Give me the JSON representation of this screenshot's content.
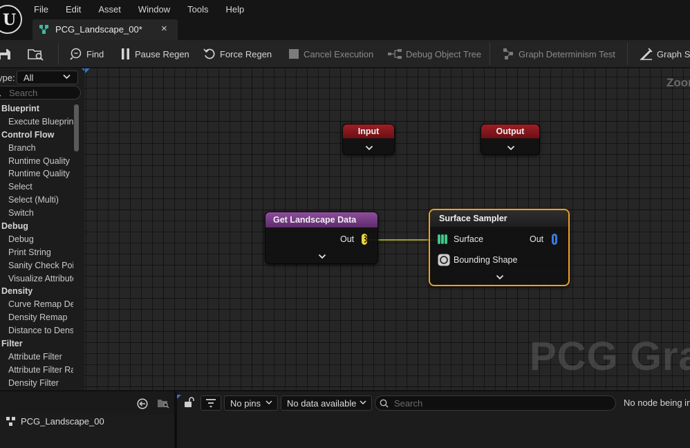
{
  "app": {
    "logo_text": "U",
    "menu": [
      "File",
      "Edit",
      "Asset",
      "Window",
      "Tools",
      "Help"
    ],
    "tab": {
      "label": "PCG_Landscape_00*",
      "close": "×"
    }
  },
  "toolbar": {
    "find": "Find",
    "pause_regen": "Pause Regen",
    "force_regen": "Force Regen",
    "cancel_execution": "Cancel Execution",
    "debug_object_tree": "Debug Object Tree",
    "graph_determinism_test": "Graph Determinism Test",
    "graph_settings": "Graph Se"
  },
  "palette": {
    "type_label": "ype:",
    "type_value": "All",
    "search_placeholder": "Search",
    "items": [
      {
        "kind": "cat",
        "label": "Blueprint"
      },
      {
        "kind": "item",
        "label": "Execute Blueprint"
      },
      {
        "kind": "cat",
        "label": "Control Flow"
      },
      {
        "kind": "item",
        "label": "Branch"
      },
      {
        "kind": "item",
        "label": "Runtime Quality"
      },
      {
        "kind": "item",
        "label": "Runtime Quality"
      },
      {
        "kind": "item",
        "label": "Select"
      },
      {
        "kind": "item",
        "label": "Select (Multi)"
      },
      {
        "kind": "item",
        "label": "Switch"
      },
      {
        "kind": "cat",
        "label": "Debug"
      },
      {
        "kind": "item",
        "label": "Debug"
      },
      {
        "kind": "item",
        "label": "Print String"
      },
      {
        "kind": "item",
        "label": "Sanity Check Point"
      },
      {
        "kind": "item",
        "label": "Visualize Attribute"
      },
      {
        "kind": "cat",
        "label": "Density"
      },
      {
        "kind": "item",
        "label": "Curve Remap Density"
      },
      {
        "kind": "item",
        "label": "Density Remap"
      },
      {
        "kind": "item",
        "label": "Distance to Density"
      },
      {
        "kind": "cat",
        "label": "Filter"
      },
      {
        "kind": "item",
        "label": "Attribute Filter"
      },
      {
        "kind": "item",
        "label": "Attribute Filter Range"
      },
      {
        "kind": "item",
        "label": "Density Filter"
      }
    ]
  },
  "graph": {
    "zoom_label": "Zoom",
    "watermark": "PCG Graph",
    "nodes": {
      "input": {
        "title": "Input"
      },
      "output": {
        "title": "Output"
      },
      "landscape": {
        "title": "Get Landscape Data",
        "out_pin": "Out"
      },
      "sampler": {
        "title": "Surface Sampler",
        "in_pin_surface": "Surface",
        "in_pin_bounding": "Bounding Shape",
        "out_pin": "Out"
      }
    }
  },
  "outliner": {
    "asset_label": "PCG_Landscape_00"
  },
  "debug_panel": {
    "pins_filter": "No pins",
    "data_filter": "No data available",
    "search_placeholder": "Search",
    "status": "No node being inspected"
  },
  "colors": {
    "selection_outline": "#f0a020",
    "input_output_header": "#9b1f26",
    "landscape_header": "#8c4e9a",
    "landscape_pin": "#e8d43a",
    "surface_pin": "#3ec88a",
    "out_point_pin": "#3a7ae0",
    "accent_blue": "#2c77d6"
  }
}
